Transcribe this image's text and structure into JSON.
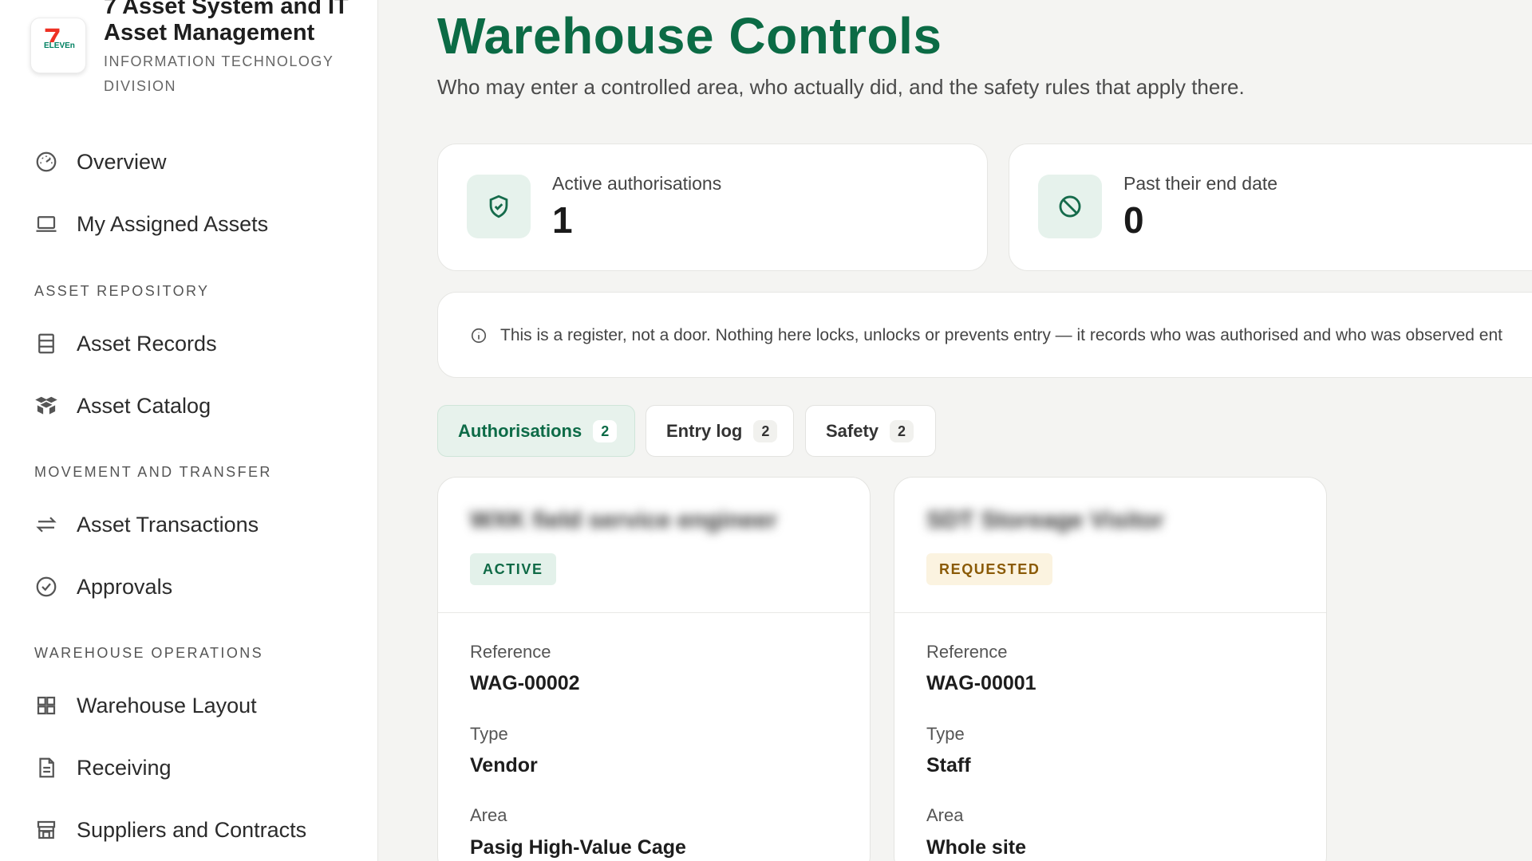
{
  "sidebar": {
    "brand": {
      "title": "7 Asset System and IT Asset Management",
      "subtitle": "Information Technology Division",
      "logo_icon": "seven-eleven-logo",
      "logo_seven": "7",
      "logo_eleven": "ELEVEn"
    },
    "nav": {
      "overview": "Overview",
      "my_assets": "My Assigned Assets",
      "section_repository": "Asset Repository",
      "asset_records": "Asset Records",
      "asset_catalog": "Asset Catalog",
      "section_movement": "Movement and Transfer",
      "asset_transactions": "Asset Transactions",
      "approvals": "Approvals",
      "section_warehouse": "Warehouse Operations",
      "warehouse_layout": "Warehouse Layout",
      "receiving": "Receiving",
      "suppliers": "Suppliers and Contracts"
    }
  },
  "header": {
    "title": "Warehouse Controls",
    "subtitle": "Who may enter a controlled area, who actually did, and the safety rules that apply there."
  },
  "stats": [
    {
      "label": "Active authorisations",
      "value": "1",
      "icon": "shield-check-icon"
    },
    {
      "label": "Past their end date",
      "value": "0",
      "icon": "ban-icon"
    }
  ],
  "notice": {
    "icon": "info-icon",
    "text": "This is a register, not a door. Nothing here locks, unlocks or prevents entry — it records who was authorised and who was observed ent"
  },
  "tabs": [
    {
      "label": "Authorisations",
      "count": "2",
      "active": true
    },
    {
      "label": "Entry log",
      "count": "2",
      "active": false
    },
    {
      "label": "Safety",
      "count": "2",
      "active": false
    }
  ],
  "cards": [
    {
      "name": "WXK field service engineer",
      "status": "ACTIVE",
      "fields": {
        "reference_label": "Reference",
        "reference": "WAG-00002",
        "type_label": "Type",
        "type": "Vendor",
        "area_label": "Area",
        "area": "Pasig High-Value Cage"
      }
    },
    {
      "name": "SDT Storeage Visitor",
      "status": "REQUESTED",
      "fields": {
        "reference_label": "Reference",
        "reference": "WAG-00001",
        "type_label": "Type",
        "type": "Staff",
        "area_label": "Area",
        "area": "Whole site"
      }
    }
  ],
  "colors": {
    "accent": "#0b6b45",
    "active_badge_bg": "#e3f1ea",
    "requested_badge_bg": "#fbf3e0",
    "requested_badge_text": "#8a5a06"
  }
}
